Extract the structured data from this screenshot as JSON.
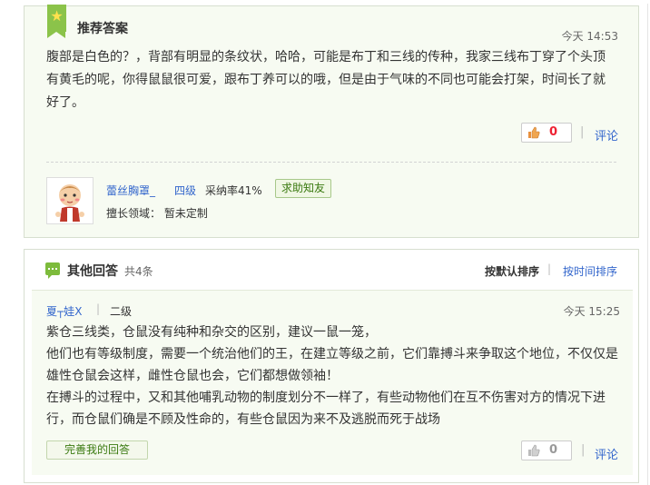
{
  "recommended": {
    "title": "推荐答案",
    "time": "今天  14:53",
    "answer": "腹部是白色的？，背部有明显的条纹状，哈哈，可能是布丁和三线的传种，我家三线布丁穿了个头顶有黄毛的呢，你得鼠鼠很可爱，跟布丁养可以的哦，但是由于气味的不同也可能会打架，时间长了就好了。",
    "likes": "0",
    "separator": "|",
    "comment_label": "评论",
    "user": {
      "name": "蕾丝胸罩_",
      "level": "四级",
      "adopt_rate": "采纳率41%",
      "help_button": "求助知友",
      "expertise": "擅长领域：  暂未定制"
    }
  },
  "other_answers": {
    "title": "其他回答",
    "count": "共4条",
    "sort_default": "按默认排序",
    "sort_separator": "|",
    "sort_time": "按时间排序",
    "items": [
      {
        "user": "夏┬娃X",
        "separator": "|",
        "level": "二级",
        "time": "今天  15:25",
        "lines": [
          "紫仓三线类，仓鼠没有纯种和杂交的区别，建议一鼠一笼，",
          "他们也有等级制度，需要一个统治他们的王，在建立等级之前，它们靠搏斗来争取这个地位，不仅仅是雄性仓鼠会这样，雌性仓鼠也会，它们都想做领袖！",
          "在搏斗的过程中，又和其他哺乳动物的制度划分不一样了，有些动物他们在互不伤害对方的情况下进行，而仓鼠们确是不顾及性命的，有些仓鼠因为来不及逃脱而死于战场"
        ],
        "improve_button": "完善我的回答",
        "likes": "0",
        "vote_separator": "|",
        "comment_label": "评论"
      }
    ]
  },
  "colors": {
    "accent_green": "#8bc34a",
    "link_blue": "#3366cc",
    "vote_red": "#ee2233",
    "panel_bg": "#f7fbf2"
  }
}
